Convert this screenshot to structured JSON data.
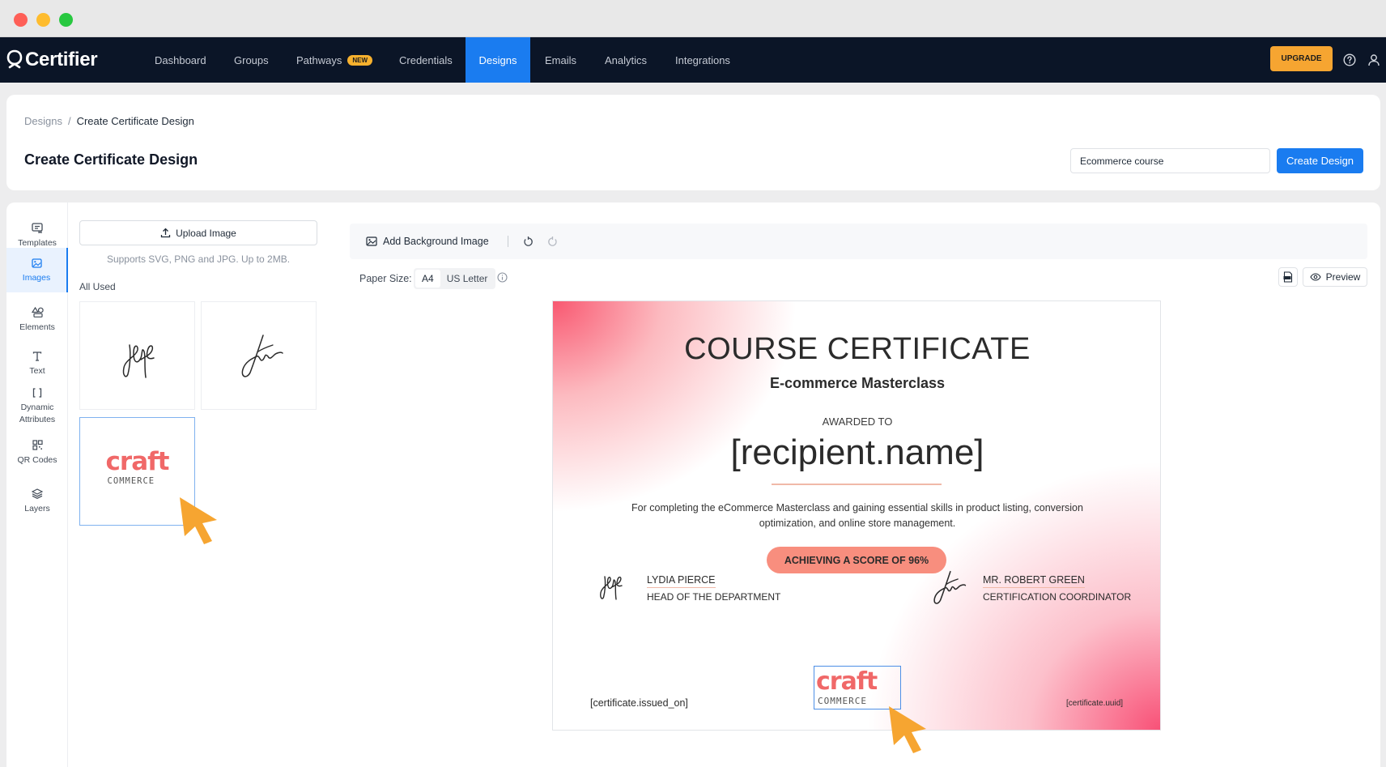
{
  "brand": {
    "name": "Certifier"
  },
  "nav": {
    "items": [
      {
        "label": "Dashboard"
      },
      {
        "label": "Groups"
      },
      {
        "label": "Pathways",
        "badge": "NEW"
      },
      {
        "label": "Credentials"
      },
      {
        "label": "Designs",
        "active": true
      },
      {
        "label": "Emails"
      },
      {
        "label": "Analytics"
      },
      {
        "label": "Integrations"
      }
    ],
    "upgrade_label": "UPGRADE"
  },
  "breadcrumb": {
    "parent": "Designs",
    "separator": "/",
    "current": "Create Certificate Design"
  },
  "page": {
    "title": "Create Certificate Design",
    "design_name_value": "Ecommerce course",
    "create_label": "Create Design"
  },
  "tools": [
    {
      "label": "Templates",
      "icon": "templates-icon"
    },
    {
      "label": "Images",
      "icon": "image-icon",
      "active": true
    },
    {
      "label": "Elements",
      "icon": "shapes-icon"
    },
    {
      "label": "Text",
      "icon": "text-icon"
    },
    {
      "label": "Dynamic Attributes",
      "icon": "brackets-icon"
    },
    {
      "label": "QR Codes",
      "icon": "qr-code-icon"
    },
    {
      "label": "Layers",
      "icon": "layers-icon"
    }
  ],
  "assets": {
    "upload_label": "Upload Image",
    "upload_hint": "Supports SVG, PNG and JPG. Up to 2MB.",
    "section_label": "All Used",
    "logo_word": "craft",
    "logo_sub": "COMMERCE"
  },
  "canvas": {
    "add_bg_label": "Add Background Image",
    "paper_size_label": "Paper Size:",
    "paper_options": [
      "A4",
      "US Letter"
    ],
    "paper_selected": "A4",
    "preview_label": "Preview"
  },
  "certificate": {
    "title": "COURSE CERTIFICATE",
    "subtitle": "E-commerce Masterclass",
    "awarded_to": "AWARDED TO",
    "recipient": "[recipient.name]",
    "description": "For completing the eCommerce Masterclass and gaining essential skills in product listing, conversion optimization, and online store management.",
    "score": "ACHIEVING A SCORE OF 96%",
    "signatory_left": {
      "name": "LYDIA PIERCE",
      "role": "HEAD OF THE DEPARTMENT"
    },
    "signatory_right": {
      "name": "MR. ROBERT GREEN",
      "role": "CERTIFICATION COORDINATOR"
    },
    "issued_on": "[certificate.issued_on]",
    "uuid": "[certificate.uuid]",
    "logo_word": "craft",
    "logo_sub": "COMMERCE"
  },
  "colors": {
    "nav_bg": "#0b1527",
    "accent": "#1a7cf0",
    "upgrade": "#f6a531",
    "score_pill": "#f88e7e",
    "cursor": "#f6a531"
  }
}
